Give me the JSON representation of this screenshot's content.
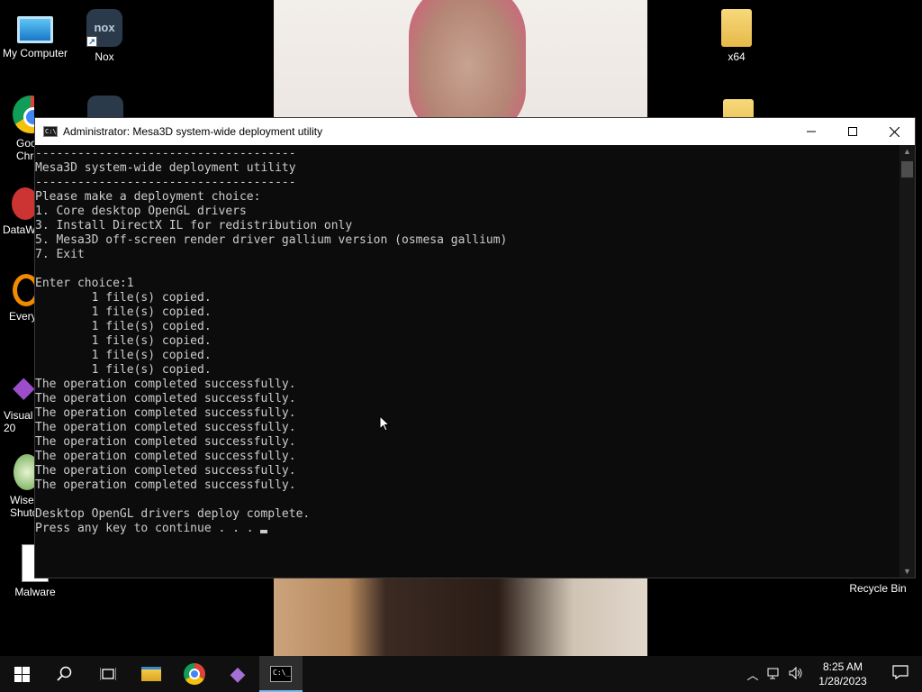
{
  "desktop": {
    "icons": {
      "my_computer": "My Computer",
      "nox": "Nox",
      "x64": "x64",
      "google_chrome": "Goo\nChro",
      "dataw": "DataW",
      "every": "Every",
      "visual": "Visual\n20",
      "wise": "Wise\nShutd",
      "malware": "Malware",
      "recycle_bin": "Recycle Bin"
    }
  },
  "console": {
    "title": "Administrator:  Mesa3D system-wide deployment utility",
    "lines": [
      "-------------------------------------",
      "Mesa3D system-wide deployment utility",
      "-------------------------------------",
      "Please make a deployment choice:",
      "1. Core desktop OpenGL drivers",
      "3. Install DirectX IL for redistribution only",
      "5. Mesa3D off-screen render driver gallium version (osmesa gallium)",
      "7. Exit",
      "",
      "Enter choice:1",
      "        1 file(s) copied.",
      "        1 file(s) copied.",
      "        1 file(s) copied.",
      "        1 file(s) copied.",
      "        1 file(s) copied.",
      "        1 file(s) copied.",
      "The operation completed successfully.",
      "The operation completed successfully.",
      "The operation completed successfully.",
      "The operation completed successfully.",
      "The operation completed successfully.",
      "The operation completed successfully.",
      "The operation completed successfully.",
      "The operation completed successfully.",
      "",
      "Desktop OpenGL drivers deploy complete.",
      "Press any key to continue . . . "
    ],
    "text_color": "#cccccc",
    "background": "#0c0c0c"
  },
  "taskbar": {
    "time": "8:25 AM",
    "date": "1/28/2023"
  }
}
